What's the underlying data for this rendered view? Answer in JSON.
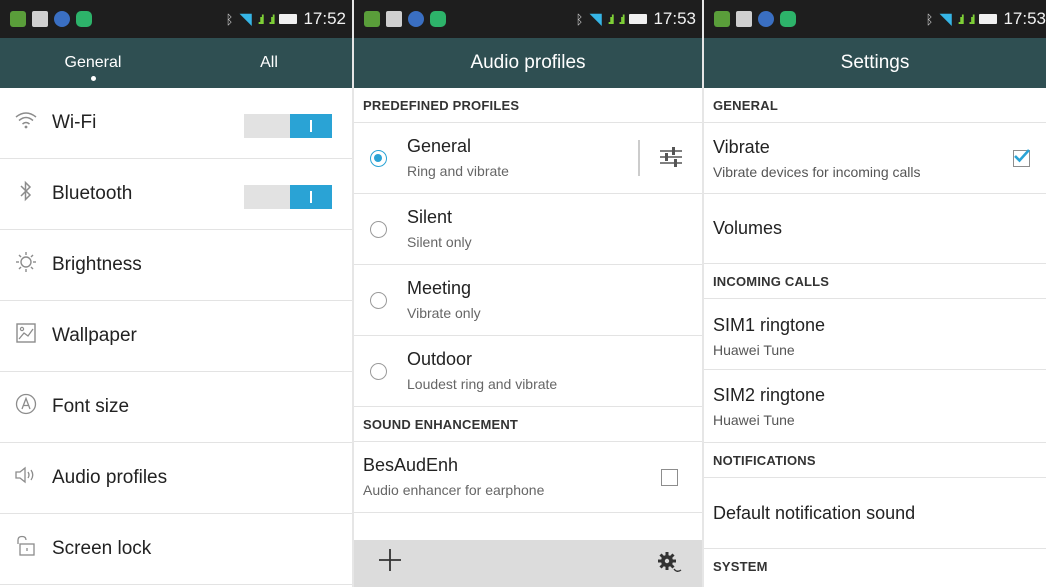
{
  "panels": {
    "general": {
      "status_time": "17:52",
      "tabs": [
        {
          "label": "General"
        },
        {
          "label": "All"
        }
      ],
      "items": [
        {
          "label": "Wi-Fi",
          "icon": "wifi-icon",
          "toggle": true
        },
        {
          "label": "Bluetooth",
          "icon": "bluetooth-icon",
          "toggle": true
        },
        {
          "label": "Brightness",
          "icon": "brightness-icon"
        },
        {
          "label": "Wallpaper",
          "icon": "wallpaper-icon"
        },
        {
          "label": "Font size",
          "icon": "font-size-icon"
        },
        {
          "label": "Audio profiles",
          "icon": "speaker-icon"
        },
        {
          "label": "Screen lock",
          "icon": "lock-icon"
        }
      ]
    },
    "audio": {
      "status_time": "17:53",
      "title": "Audio profiles",
      "section_predefined": "PREDEFINED PROFILES",
      "profiles": [
        {
          "title": "General",
          "subtitle": "Ring and vibrate",
          "selected": true
        },
        {
          "title": "Silent",
          "subtitle": "Silent only",
          "selected": false
        },
        {
          "title": "Meeting",
          "subtitle": "Vibrate only",
          "selected": false
        },
        {
          "title": "Outdoor",
          "subtitle": "Loudest ring and vibrate",
          "selected": false
        }
      ],
      "section_sound": "SOUND ENHANCEMENT",
      "enhancer": {
        "title": "BesAudEnh",
        "subtitle": "Audio enhancer for earphone",
        "checked": false
      }
    },
    "settings": {
      "status_time": "17:53",
      "title": "Settings",
      "section_general": "GENERAL",
      "vibrate": {
        "title": "Vibrate",
        "subtitle": "Vibrate devices for incoming calls",
        "checked": true
      },
      "volumes": "Volumes",
      "section_incoming": "INCOMING CALLS",
      "sim1": {
        "title": "SIM1 ringtone",
        "subtitle": "Huawei Tune"
      },
      "sim2": {
        "title": "SIM2 ringtone",
        "subtitle": "Huawei Tune"
      },
      "section_notifications": "NOTIFICATIONS",
      "default_notification": "Default notification sound",
      "section_system": "SYSTEM"
    }
  },
  "colors": {
    "accent": "#2aa3d5",
    "header": "#2f4f52",
    "statusbar": "#1e1e1e",
    "signal": "#7fd137"
  }
}
